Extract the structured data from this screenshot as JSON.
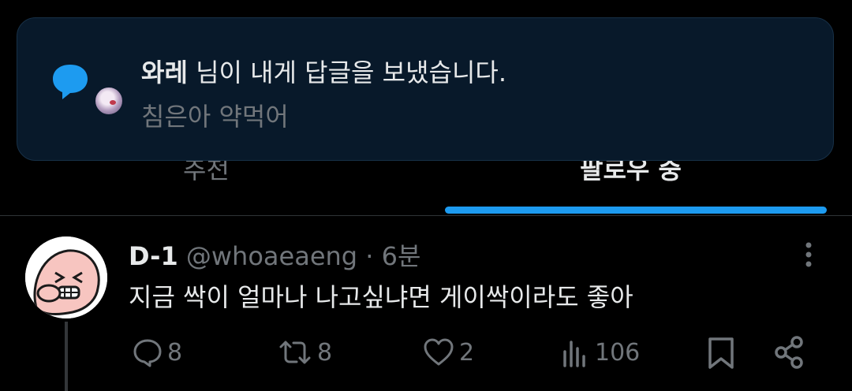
{
  "tabs": {
    "recommended": "추천",
    "following": "팔로우 중"
  },
  "toast": {
    "sender": "와레",
    "message": " 님이 내게 답글을 보냈습니다.",
    "preview": "침은아 약먹어",
    "icon": "speech-bubble-icon"
  },
  "post": {
    "name": "D-1",
    "handle": "@whoaeaeng",
    "dot": " · ",
    "time": "6분",
    "text": "지금 싹이 얼마나 나고싶냐면 게이싹이라도 좋아",
    "actions": {
      "replies": "8",
      "reposts": "8",
      "likes": "2",
      "views": "106"
    }
  },
  "colors": {
    "accent": "#1d9bf0",
    "background": "#000000",
    "toast_bg": "#08192a",
    "muted": "#71767b"
  }
}
